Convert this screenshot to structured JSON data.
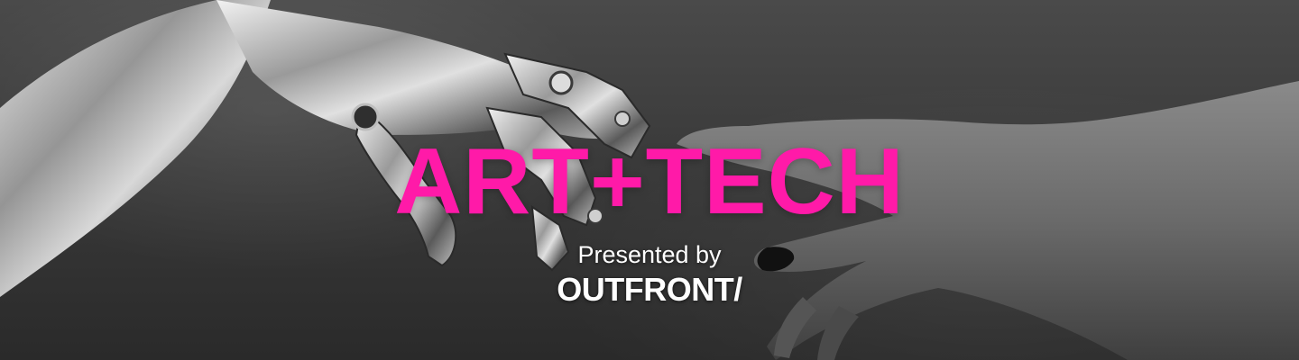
{
  "banner": {
    "title": "ART+TECH",
    "presented_by": "Presented by",
    "logo_text": "OUTFRONT/"
  },
  "colors": {
    "title": "#ff1aa8",
    "text": "#ffffff",
    "background": "#3a3a3a"
  },
  "images": {
    "background_photo": "robotic-hand-reaching-human-hand"
  }
}
